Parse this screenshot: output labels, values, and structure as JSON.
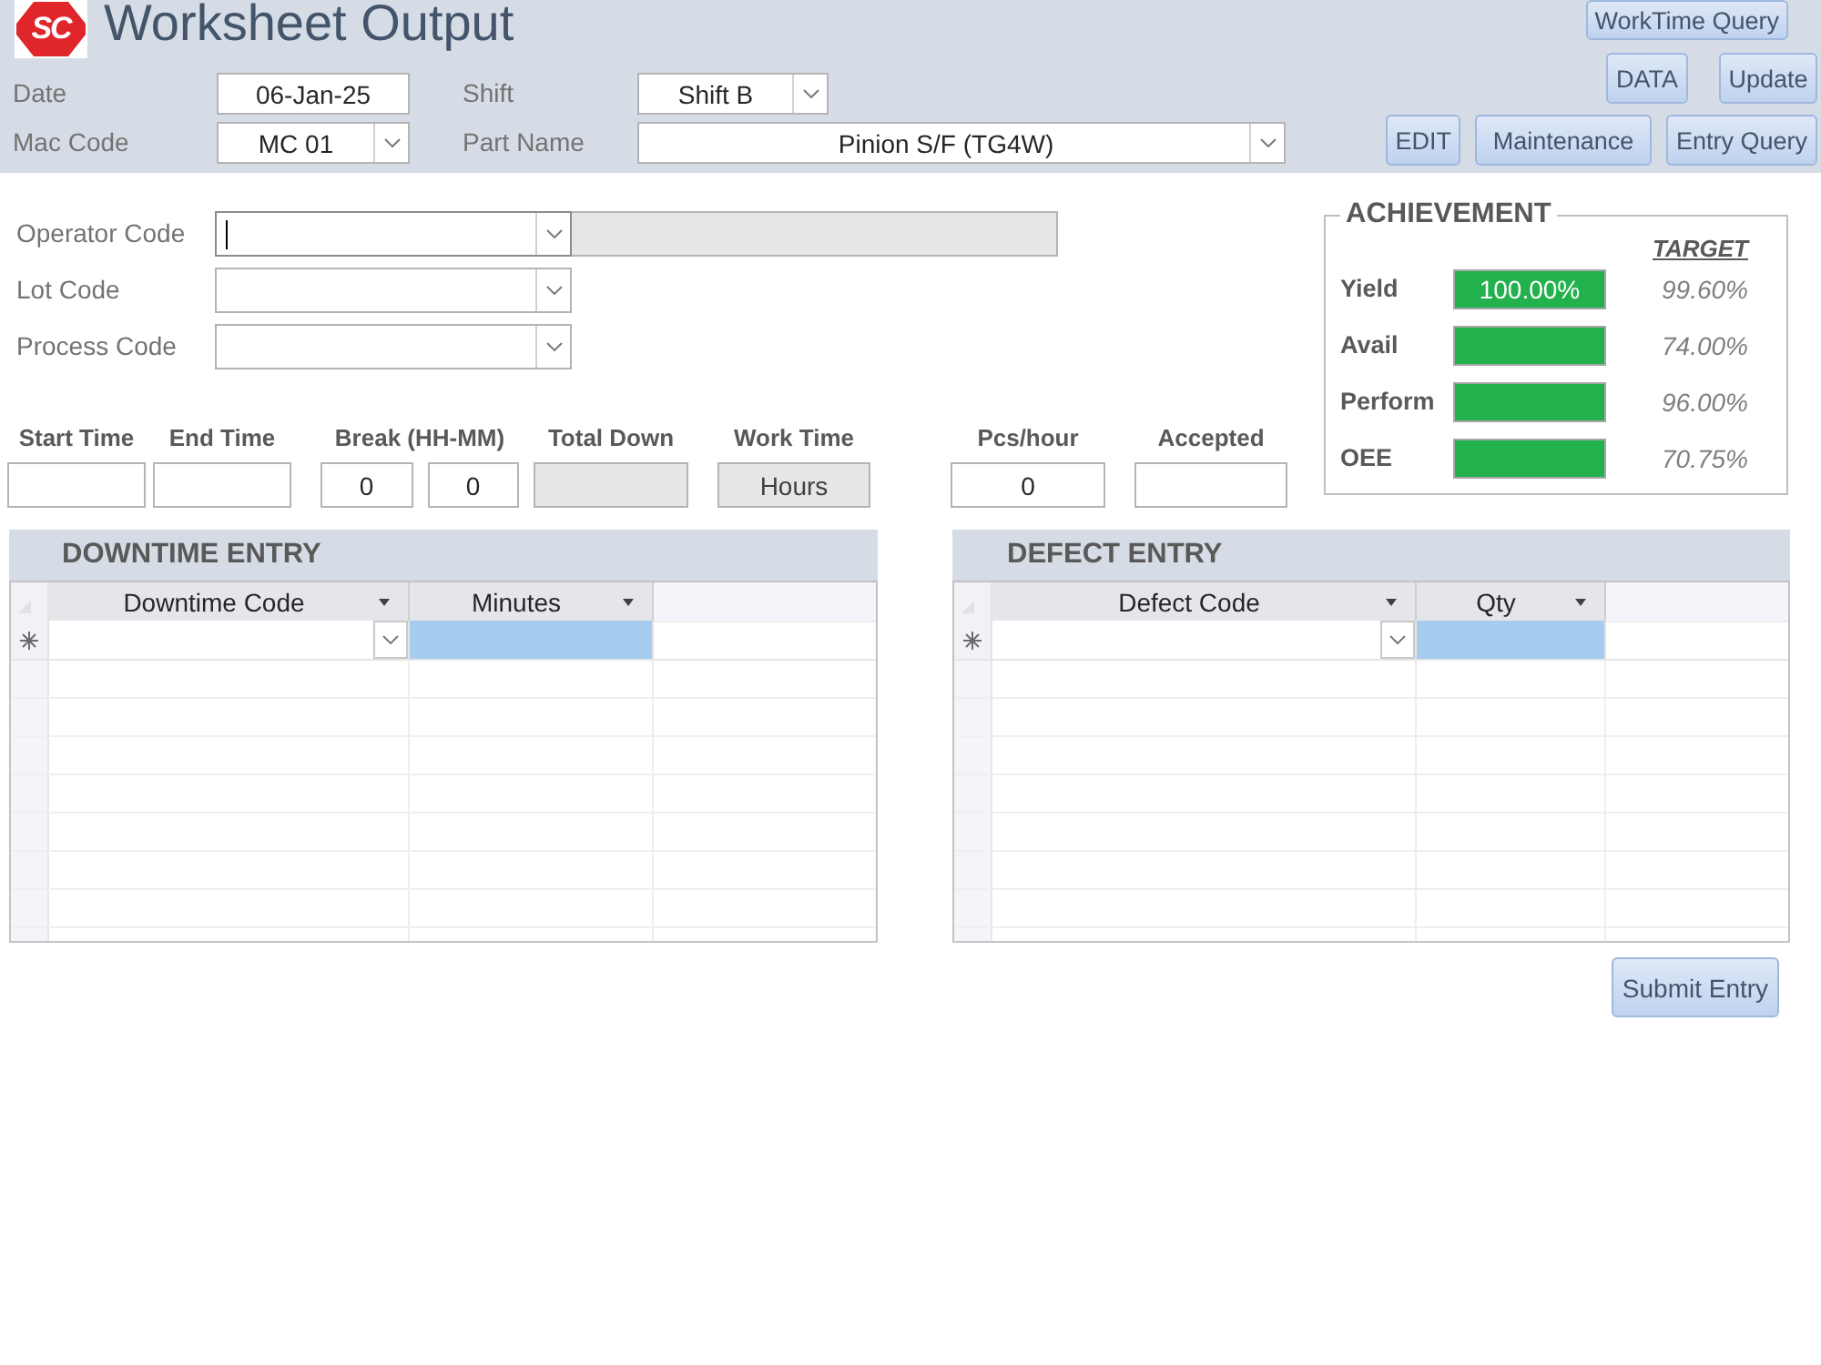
{
  "header": {
    "logo_text": "SC",
    "title": "Worksheet Output",
    "fields": [
      {
        "label": "Date",
        "kind": "text",
        "value": "06-Jan-25"
      },
      {
        "label": "Shift",
        "kind": "combo",
        "value": "Shift B"
      },
      {
        "label": "Mac Code",
        "kind": "combo",
        "value": "MC 01"
      },
      {
        "label": "Part Name",
        "kind": "combo",
        "value": "Pinion S/F (TG4W)"
      }
    ],
    "button_rows": [
      [
        "WorkTime Query"
      ],
      [
        "DATA",
        "Update"
      ],
      [
        "EDIT",
        "Maintenance",
        "Entry Query"
      ]
    ]
  },
  "record_fields": [
    {
      "label": "Operator Code",
      "focused": true,
      "linked_display": true
    },
    {
      "label": "Lot Code",
      "focused": false,
      "linked_display": false
    },
    {
      "label": "Process Code",
      "focused": false,
      "linked_display": false
    }
  ],
  "time_fields": [
    {
      "label": "Start Time",
      "inputs": [
        {
          "kind": "text"
        }
      ]
    },
    {
      "label": "End Time",
      "inputs": [
        {
          "kind": "text"
        }
      ]
    },
    {
      "label": "Break (HH-MM)",
      "inputs": [
        {
          "kind": "text",
          "value": "0"
        },
        {
          "kind": "text",
          "value": "0"
        }
      ]
    },
    {
      "label": "Total Down",
      "inputs": [
        {
          "kind": "display"
        }
      ]
    },
    {
      "label": "Work Time",
      "inputs": [
        {
          "kind": "display",
          "value": "Hours"
        }
      ]
    },
    {
      "label": "Pcs/hour",
      "inputs": [
        {
          "kind": "text",
          "value": "0"
        }
      ]
    },
    {
      "label": "Accepted",
      "inputs": [
        {
          "kind": "text"
        }
      ]
    }
  ],
  "achievement": {
    "title": "ACHIEVEMENT",
    "target_heading": "TARGET",
    "rows": [
      {
        "label": "Yield",
        "value": "100.00%",
        "highlighted": true,
        "target": "99.60%"
      },
      {
        "label": "Avail",
        "highlighted": true,
        "target": "74.00%"
      },
      {
        "label": "Perform",
        "highlighted": true,
        "target": "96.00%"
      },
      {
        "label": "OEE",
        "highlighted": true,
        "target": "70.75%"
      }
    ]
  },
  "grids": [
    {
      "title": "DOWNTIME ENTRY",
      "columns": [
        "Downtime Code",
        "Minutes"
      ],
      "new_row": [
        {
          "kind": "combo",
          "selected": false
        },
        {
          "kind": "text",
          "selected": true
        }
      ]
    },
    {
      "title": "DEFECT ENTRY",
      "columns": [
        "Defect Code",
        "Qty"
      ],
      "new_row": [
        {
          "kind": "combo",
          "selected": false
        },
        {
          "kind": "text",
          "selected": true
        }
      ]
    }
  ],
  "submit_button": "Submit Entry"
}
